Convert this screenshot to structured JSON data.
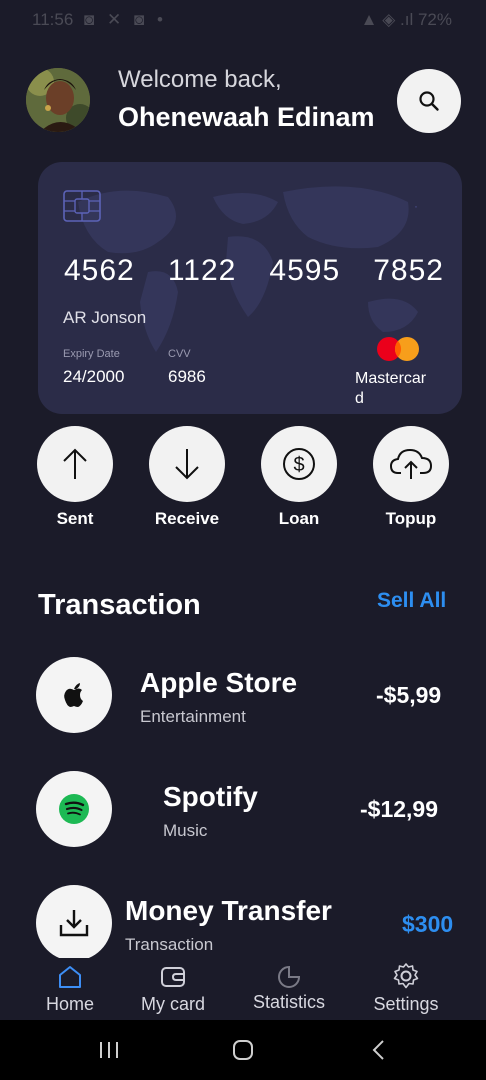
{
  "status_bar": {
    "time": "11:56",
    "battery": "72%"
  },
  "header": {
    "welcome": "Welcome back,",
    "username": "Ohenewaah Edinam"
  },
  "card": {
    "number_groups": [
      "4562",
      "1122",
      "4595",
      "7852"
    ],
    "holder": "AR Jonson",
    "expiry_label": "Expiry Date",
    "expiry_value": "24/2000",
    "cvv_label": "CVV",
    "cvv_value": "6986",
    "network": "Mastercard"
  },
  "actions": [
    {
      "label": "Sent",
      "icon": "arrow-up-icon"
    },
    {
      "label": "Receive",
      "icon": "arrow-down-icon"
    },
    {
      "label": "Loan",
      "icon": "dollar-icon"
    },
    {
      "label": "Topup",
      "icon": "cloud-upload-icon"
    }
  ],
  "transactions_section": {
    "title": "Transaction",
    "see_all": "Sell All"
  },
  "transactions": [
    {
      "name": "Apple Store",
      "category": "Entertainment",
      "amount": "-$5,99",
      "icon": "apple-icon"
    },
    {
      "name": "Spotify",
      "category": "Music",
      "amount": "-$12,99",
      "icon": "spotify-icon"
    },
    {
      "name": "Money Transfer",
      "category": "Transaction",
      "amount": "$300",
      "icon": "download-icon"
    }
  ],
  "bottom_nav": [
    {
      "label": "Home",
      "icon": "home-icon"
    },
    {
      "label": "My card",
      "icon": "wallet-icon"
    },
    {
      "label": "Statistics",
      "icon": "pie-chart-icon"
    },
    {
      "label": "Settings",
      "icon": "gear-icon"
    }
  ],
  "colors": {
    "background": "#1b1b29",
    "card": "#2b2c48",
    "accent": "#2d8ef0",
    "button": "#f2f2f2"
  }
}
